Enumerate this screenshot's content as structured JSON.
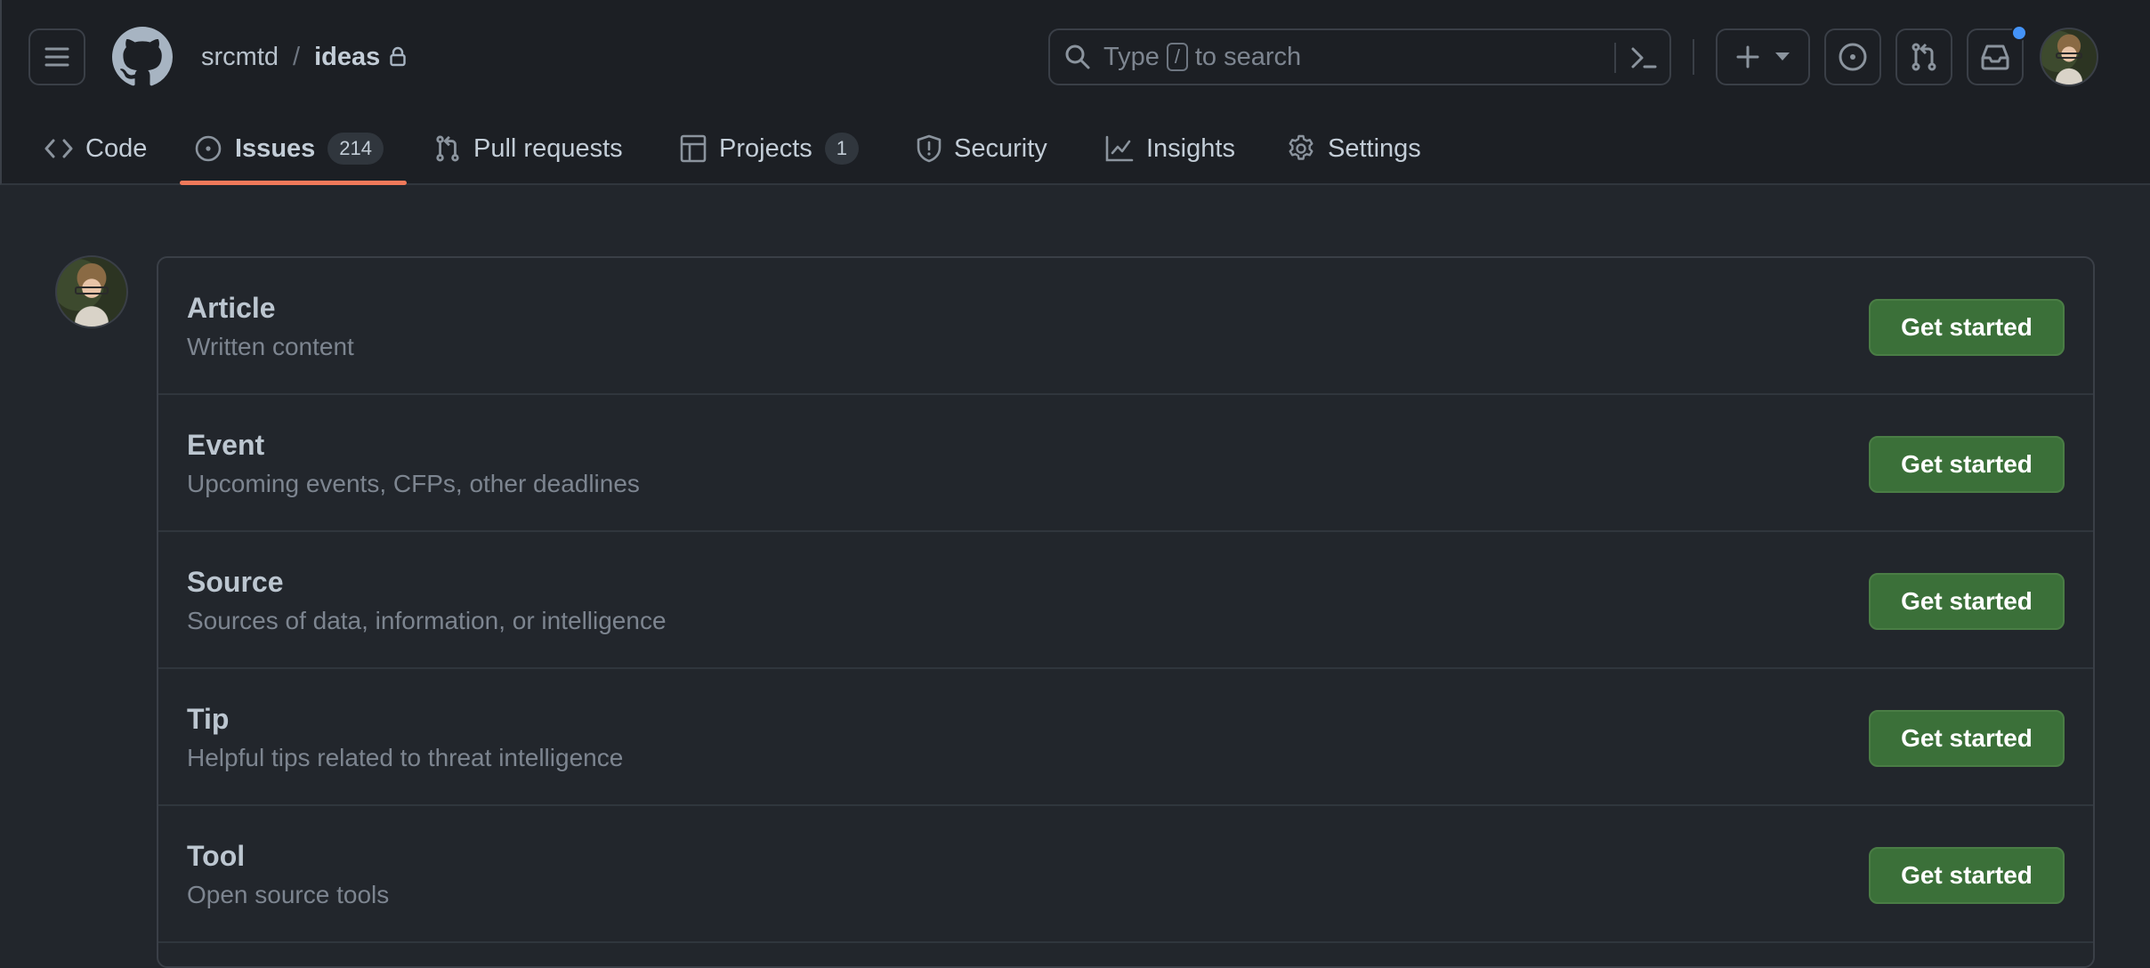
{
  "header": {
    "owner": "srcmtd",
    "separator": "/",
    "repo": "ideas",
    "repo_visibility_icon": "lock-icon",
    "search": {
      "placeholder_prefix": "Type",
      "shortcut_key": "/",
      "placeholder_suffix": "to search"
    },
    "notification_indicator": true,
    "colors": {
      "notification_dot": "#4493f8"
    }
  },
  "tabs": [
    {
      "label": "Code",
      "icon": "code-icon"
    },
    {
      "label": "Issues",
      "icon": "issue-opened-icon",
      "count": "214",
      "active": true
    },
    {
      "label": "Pull requests",
      "icon": "git-pull-request-icon"
    },
    {
      "label": "Projects",
      "icon": "table-icon",
      "count": "1"
    },
    {
      "label": "Security",
      "icon": "shield-icon"
    },
    {
      "label": "Insights",
      "icon": "graph-icon"
    },
    {
      "label": "Settings",
      "icon": "gear-icon"
    }
  ],
  "templates": [
    {
      "name": "Article",
      "description": "Written content",
      "button": "Get started"
    },
    {
      "name": "Event",
      "description": "Upcoming events, CFPs, other deadlines",
      "button": "Get started"
    },
    {
      "name": "Source",
      "description": "Sources of data, information, or intelligence",
      "button": "Get started"
    },
    {
      "name": "Tip",
      "description": "Helpful tips related to threat intelligence",
      "button": "Get started"
    },
    {
      "name": "Tool",
      "description": "Open source tools",
      "button": "Get started"
    }
  ],
  "colors": {
    "active_tab_underline": "#f0795a",
    "primary_button": "#3b7039"
  }
}
